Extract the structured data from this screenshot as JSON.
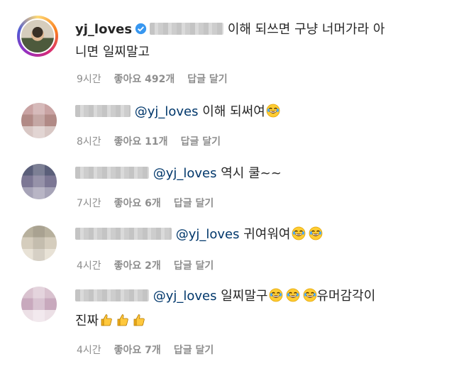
{
  "comments": [
    {
      "author": "yj_loves",
      "verified": true,
      "text_line1": "이해 되쓰면 구냥 너머가라 아",
      "text_line2": "니면 일찌말고",
      "time": "9시간",
      "likes": "좋아요 492개",
      "reply": "답글 달기"
    },
    {
      "mention": "@yj_loves",
      "text": "이해 되써여",
      "emojis": [
        "laughing-tears"
      ],
      "time": "8시간",
      "likes": "좋아요 11개",
      "reply": "답글 달기"
    },
    {
      "mention": "@yj_loves",
      "text": "역시 쿨~~",
      "time": "7시간",
      "likes": "좋아요 6개",
      "reply": "답글 달기"
    },
    {
      "mention": "@yj_loves",
      "text": "귀여워여",
      "emojis": [
        "laughing-tears",
        "laughing-tears"
      ],
      "time": "4시간",
      "likes": "좋아요 2개",
      "reply": "답글 달기"
    },
    {
      "mention": "@yj_loves",
      "text": "일찌말구",
      "text2": "유머감각이",
      "text_line2": "진짜",
      "emojis": [
        "laughing-tears",
        "laughing-tears",
        "laughing-tears"
      ],
      "emojis2": [
        "thumbs-up",
        "thumbs-up",
        "thumbs-up"
      ],
      "time": "4시간",
      "likes": "좋아요 7개",
      "reply": "답글 달기"
    }
  ],
  "colors": {
    "mention": "#00376b",
    "meta": "#8e8e8e",
    "verified": "#3897f0"
  }
}
